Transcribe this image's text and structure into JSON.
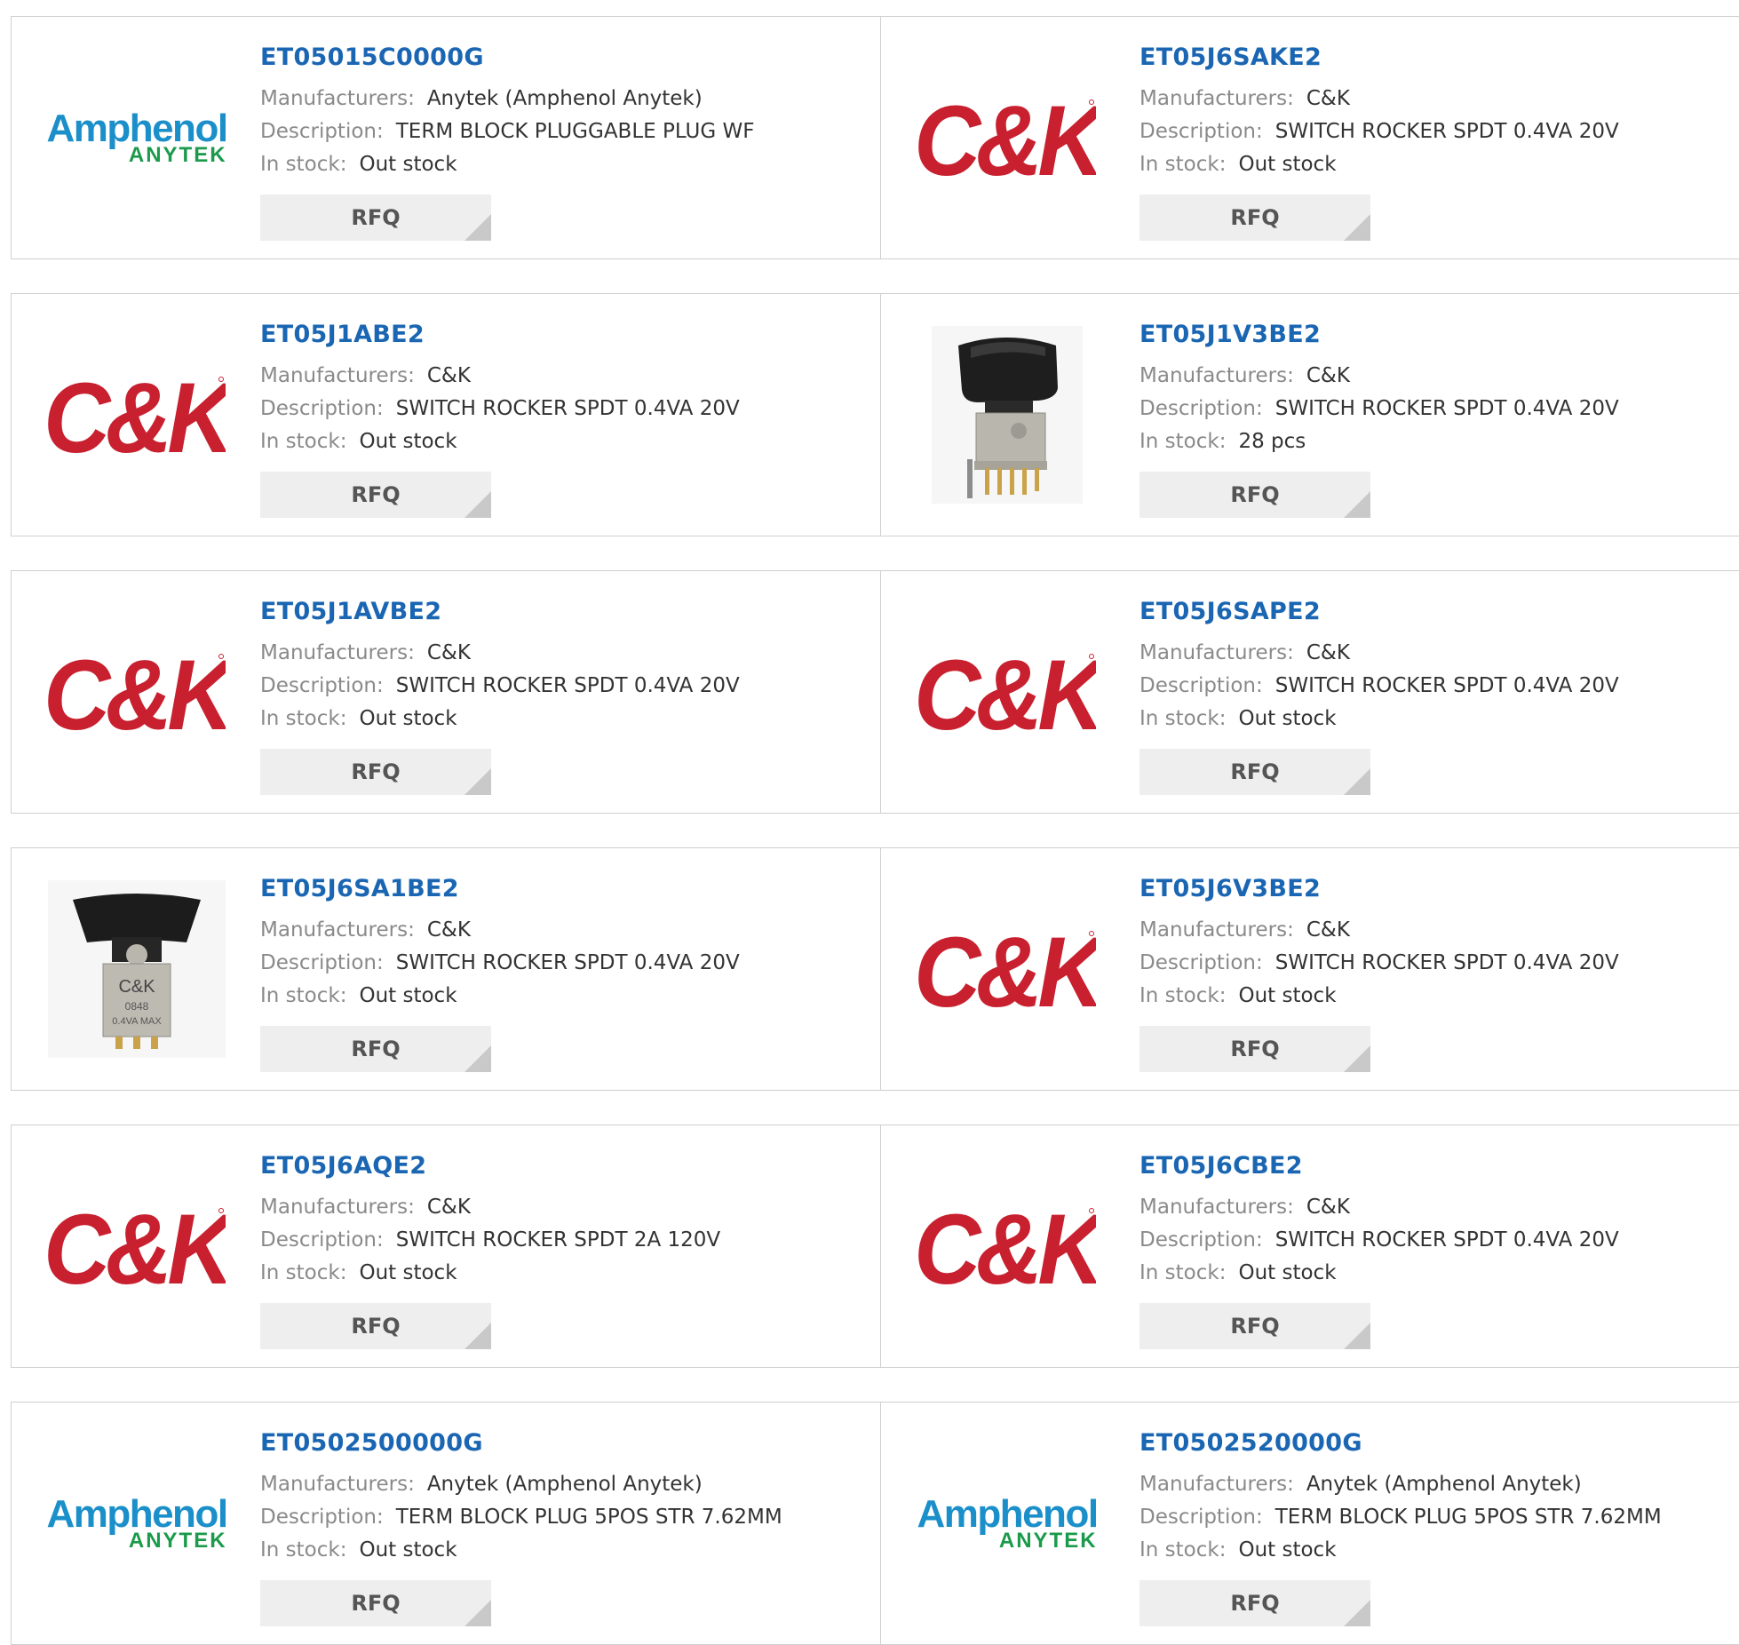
{
  "labels": {
    "manufacturers": "Manufacturers:",
    "description": "Description:",
    "in_stock": "In stock:",
    "rfq": "RFQ"
  },
  "logos": {
    "amphenol_line1": "Amphenol",
    "amphenol_line2": "ANYTEK",
    "ck": "C&K",
    "ck_switch_marking": "C&K 0848 0.4VA MAX"
  },
  "colors": {
    "part_number_link": "#1a66b3",
    "ck_red": "#c8202f",
    "amphenol_blue": "#1b8fc9",
    "anytek_green": "#1a9a4a",
    "rfq_bg": "#eeeeee"
  },
  "products": [
    {
      "part": "ET05015C0000G",
      "manufacturer": "Anytek (Amphenol Anytek)",
      "description": "TERM BLOCK PLUGGABLE PLUG WF",
      "stock": "Out stock",
      "image": "amphenol-logo"
    },
    {
      "part": "ET05J6SAKE2",
      "manufacturer": "C&K",
      "description": "SWITCH ROCKER SPDT 0.4VA 20V",
      "stock": "Out stock",
      "image": "ck-logo"
    },
    {
      "part": "ET05J1ABE2",
      "manufacturer": "C&K",
      "description": "SWITCH ROCKER SPDT 0.4VA 20V",
      "stock": "Out stock",
      "image": "ck-logo"
    },
    {
      "part": "ET05J1V3BE2",
      "manufacturer": "C&K",
      "description": "SWITCH ROCKER SPDT 0.4VA 20V",
      "stock": "28 pcs",
      "image": "rocker-switch-side-photo"
    },
    {
      "part": "ET05J1AVBE2",
      "manufacturer": "C&K",
      "description": "SWITCH ROCKER SPDT 0.4VA 20V",
      "stock": "Out stock",
      "image": "ck-logo"
    },
    {
      "part": "ET05J6SAPE2",
      "manufacturer": "C&K",
      "description": "SWITCH ROCKER SPDT 0.4VA 20V",
      "stock": "Out stock",
      "image": "ck-logo"
    },
    {
      "part": "ET05J6SA1BE2",
      "manufacturer": "C&K",
      "description": "SWITCH ROCKER SPDT 0.4VA 20V",
      "stock": "Out stock",
      "image": "rocker-switch-front-photo"
    },
    {
      "part": "ET05J6V3BE2",
      "manufacturer": "C&K",
      "description": "SWITCH ROCKER SPDT 0.4VA 20V",
      "stock": "Out stock",
      "image": "ck-logo"
    },
    {
      "part": "ET05J6AQE2",
      "manufacturer": "C&K",
      "description": "SWITCH ROCKER SPDT 2A 120V",
      "stock": "Out stock",
      "image": "ck-logo"
    },
    {
      "part": "ET05J6CBE2",
      "manufacturer": "C&K",
      "description": "SWITCH ROCKER SPDT 0.4VA 20V",
      "stock": "Out stock",
      "image": "ck-logo"
    },
    {
      "part": "ET0502500000G",
      "manufacturer": "Anytek (Amphenol Anytek)",
      "description": "TERM BLOCK PLUG 5POS STR 7.62MM",
      "stock": "Out stock",
      "image": "amphenol-logo"
    },
    {
      "part": "ET0502520000G",
      "manufacturer": "Anytek (Amphenol Anytek)",
      "description": "TERM BLOCK PLUG 5POS STR 7.62MM",
      "stock": "Out stock",
      "image": "amphenol-logo"
    }
  ]
}
